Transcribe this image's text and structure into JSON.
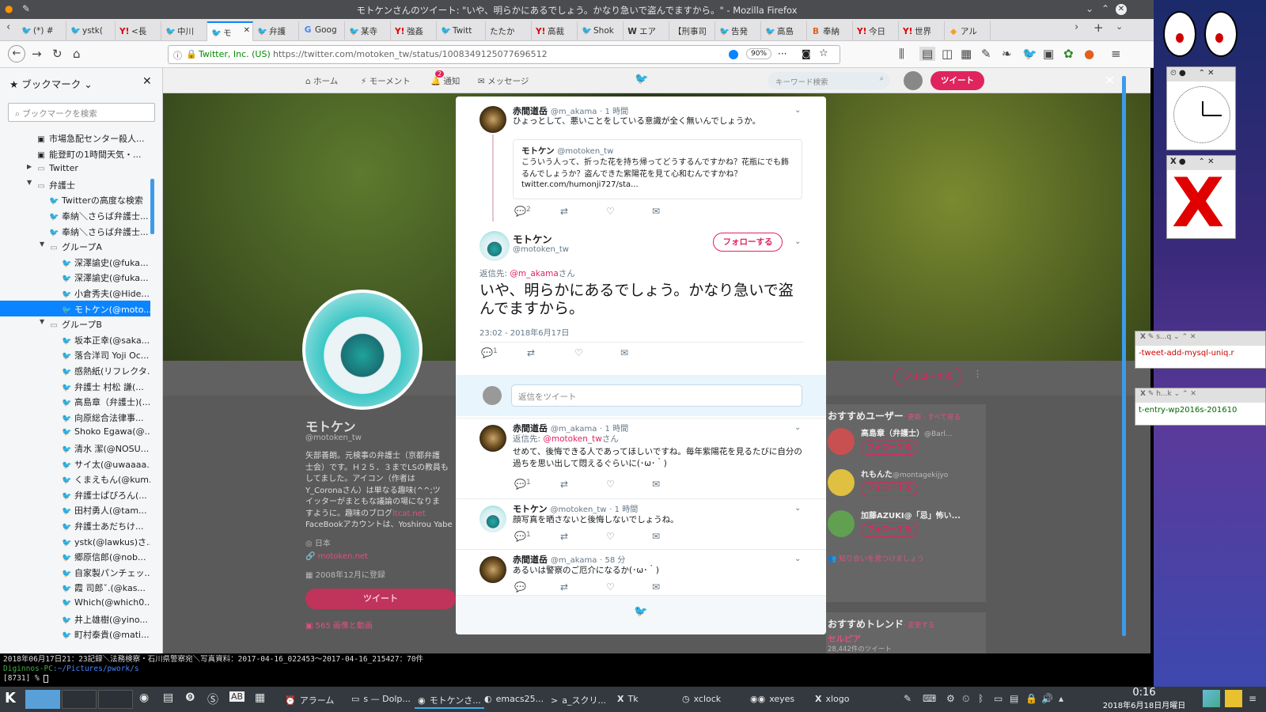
{
  "window": {
    "title": "モトケンさんのツイート: \"いや、明らかにあるでしょう。かなり急いで盗んでますから。\" - Mozilla Firefox"
  },
  "tabs": [
    {
      "label": "(*) #",
      "icon": "t"
    },
    {
      "label": "ystk(",
      "icon": "t"
    },
    {
      "label": "<長",
      "icon": "y"
    },
    {
      "label": "中川",
      "icon": "t"
    },
    {
      "label": "モ",
      "icon": "t",
      "active": true
    },
    {
      "label": "弁護",
      "icon": "t"
    },
    {
      "label": "Goog",
      "icon": "g"
    },
    {
      "label": "某寺",
      "icon": "t"
    },
    {
      "label": "強姦",
      "icon": "y"
    },
    {
      "label": "Twitt",
      "icon": "t"
    },
    {
      "label": "たたか",
      "icon": ""
    },
    {
      "label": "高裁",
      "icon": "y"
    },
    {
      "label": "Shok",
      "icon": "t"
    },
    {
      "label": "エア",
      "icon": "w"
    },
    {
      "label": "【刑事司",
      "icon": ""
    },
    {
      "label": "告発",
      "icon": "t"
    },
    {
      "label": "高島",
      "icon": "t"
    },
    {
      "label": "奉納",
      "icon": "b"
    },
    {
      "label": "今日",
      "icon": "y"
    },
    {
      "label": "世界",
      "icon": "y"
    },
    {
      "label": "アル",
      "icon": "c"
    }
  ],
  "urlbar": {
    "cert": "Twitter, Inc. (US)",
    "url": "https://twitter.com/motoken_tw/status/1008349125077696512",
    "zoom": "90%"
  },
  "sidebar": {
    "title": "ブックマーク",
    "search_placeholder": "ブックマークを検索",
    "items": [
      {
        "label": "市場急配センター殺人...",
        "type": "page",
        "indent": 0
      },
      {
        "label": "能登町の1時間天気・...",
        "type": "page",
        "indent": 0
      },
      {
        "label": "Twitter",
        "type": "folder-closed",
        "indent": 0
      },
      {
        "label": "弁護士",
        "type": "folder-open",
        "indent": 0
      },
      {
        "label": "Twitterの高度な検索",
        "type": "tw",
        "indent": 1
      },
      {
        "label": "奉納＼さらば弁護士...",
        "type": "tw",
        "indent": 1
      },
      {
        "label": "奉納＼さらば弁護士...",
        "type": "tw",
        "indent": 1
      },
      {
        "label": "グループA",
        "type": "folder-open",
        "indent": 1
      },
      {
        "label": "深澤諭史(@fuka...",
        "type": "tw",
        "indent": 2
      },
      {
        "label": "深澤諭史(@fuka...",
        "type": "tw",
        "indent": 2
      },
      {
        "label": "小倉秀夫(@Hide...",
        "type": "tw",
        "indent": 2
      },
      {
        "label": "モトケン(@moto...",
        "type": "tw",
        "indent": 2,
        "selected": true
      },
      {
        "label": "グループB",
        "type": "folder-open",
        "indent": 1
      },
      {
        "label": "坂本正幸(@saka...",
        "type": "tw",
        "indent": 2
      },
      {
        "label": "落合洋司 Yoji Oc...",
        "type": "tw",
        "indent": 2
      },
      {
        "label": "感熱紙(リフレクタ...",
        "type": "tw",
        "indent": 2
      },
      {
        "label": "弁護士 村松 謙(...",
        "type": "tw",
        "indent": 2
      },
      {
        "label": "高島章（弁護士)(...",
        "type": "tw",
        "indent": 2
      },
      {
        "label": "向原総合法律事...",
        "type": "tw",
        "indent": 2
      },
      {
        "label": "Shoko Egawa(@...",
        "type": "tw",
        "indent": 2
      },
      {
        "label": "清水 潔(@NOSU...",
        "type": "tw",
        "indent": 2
      },
      {
        "label": "サイ太(@uwaaaa...",
        "type": "tw",
        "indent": 2
      },
      {
        "label": "くまえもん(@kum...",
        "type": "tw",
        "indent": 2
      },
      {
        "label": "弁護士ぱぴろん(...",
        "type": "tw",
        "indent": 2
      },
      {
        "label": "田村勇人(@tam...",
        "type": "tw",
        "indent": 2
      },
      {
        "label": "弁護士あだちけ...",
        "type": "tw",
        "indent": 2
      },
      {
        "label": "ystk(@lawkus)さ...",
        "type": "tw",
        "indent": 2
      },
      {
        "label": "郷原信郎(@nob...",
        "type": "tw",
        "indent": 2
      },
      {
        "label": "自家製パンチェッ...",
        "type": "tw",
        "indent": 2
      },
      {
        "label": "霞 司郎ˇ.(@kas...",
        "type": "tw",
        "indent": 2
      },
      {
        "label": "Which(@which0...",
        "type": "tw",
        "indent": 2
      },
      {
        "label": "井上雄樹(@yino...",
        "type": "tw",
        "indent": 2
      },
      {
        "label": "町村泰貴(@mati...",
        "type": "tw",
        "indent": 2
      }
    ]
  },
  "twitter_nav": {
    "home": "ホーム",
    "moments": "モーメント",
    "notifications": "通知",
    "notif_badge": "2",
    "messages": "メッセージ",
    "search_placeholder": "キーワード検索",
    "tweet_button": "ツイート"
  },
  "profile": {
    "name": "モトケン",
    "handle": "@motoken_tw",
    "bio_lines": [
      "矢部善朗。元検事の弁護士（京都弁護",
      "士会）です。Ｈ２５．３までLSの教員も",
      "してました。アイコン（作者は",
      "Y_Coronaさん）は単なる趣味(^^;ツ",
      "イッターがまともな議論の場になりま",
      "すように。趣味のブログ",
      "FaceBookアカウントは、Yoshirou Yabe"
    ],
    "blog_link": "ltcat.net",
    "location": "日本",
    "website": "motoken.net",
    "joined": "2008年12月に登録",
    "tweet_button": "ツイート",
    "media": "565 画像と動画",
    "follow_button": "フォローする"
  },
  "recommend": {
    "title": "おすすめユーザー",
    "links": "· 更新 · すべて見る",
    "users": [
      {
        "name": "高島章（弁護士）",
        "handle": "@Barl...",
        "button": "フォローする"
      },
      {
        "name": "れもんた",
        "handle": "@montagekijyo",
        "button": "フォローする"
      },
      {
        "name": "加藤AZUKI@「忌」怖い...",
        "handle": "",
        "button": "フォローする"
      }
    ],
    "find_friends": "知り合いを見つけましょう",
    "trends_title": "おすすめトレンド",
    "trends_change": "· 変更する",
    "trend_name": "セルピア",
    "trend_count": "28,442件のツイート"
  },
  "modal": {
    "parent": {
      "name": "赤間道岳",
      "handle": "@m_akama",
      "time": "· 1 時間",
      "text": "ひょっとして、悪いことをしている意識が全く無いんでしょうか。",
      "quote_name": "モトケン",
      "quote_handle": "@motoken_tw",
      "quote_text": "こういう人って、折った花を持ち帰ってどうするんですかね？花瓶にでも飾るんでしょうか？盗んできた紫陽花を見て心和むんですかね？",
      "quote_link": "twitter.com/humonji727/sta...",
      "replies": "2"
    },
    "main": {
      "name": "モトケン",
      "handle": "@motoken_tw",
      "follow": "フォローする",
      "reply_prefix": "返信先: ",
      "reply_user": "@m_akama",
      "reply_suffix": "さん",
      "text": "いや、明らかにあるでしょう。かなり急いで盗んでますから。",
      "timestamp": "23:02 - 2018年6月17日",
      "replies": "1"
    },
    "reply_placeholder": "返信をツイート",
    "replies": [
      {
        "name": "赤間道岳",
        "handle": "@m_akama",
        "time": "· 1 時間",
        "reply_user": "@motoken_tw",
        "text": "せめて、後悔できる人であってほしいですね。毎年紫陽花を見るたびに自分の過ちを思い出して悶えるぐらいに(･ω･｀)",
        "count": "1",
        "avatar": "kin"
      },
      {
        "name": "モトケン",
        "handle": "@motoken_tw",
        "time": "· 1 時間",
        "reply_user": "",
        "text": "顔写真を晒さないと後悔しないでしょうね。",
        "count": "1",
        "avatar": "mk"
      },
      {
        "name": "赤間道岳",
        "handle": "@m_akama",
        "time": "· 58 分",
        "reply_user": "",
        "text": "あるいは警察のご厄介になるか(･ω･｀)",
        "count": "",
        "avatar": "kin"
      }
    ]
  },
  "right_windows": [
    {
      "text": "-tweet-add-mysql-uniq.r",
      "title": "s...q"
    },
    {
      "text": "t-entry-wp2016s-201610",
      "title": "h...k"
    }
  ],
  "terminal": {
    "line1": "2018年06月17日21：23記録＼法務検察・石川県警察宛＼写真資料：2017-04-16_022453〜2017-04-16_215427：70件",
    "prompt_host": "Diginnos-PC",
    "prompt_path": ":~/Pictures/pwork/s",
    "line3": "[8731]  % "
  },
  "taskbar": {
    "items": [
      "アラーム",
      "s — Dolp...",
      "モトケンさ...",
      "emacs25...",
      "a_スクリ...",
      "Tk",
      "xclock",
      "xeyes",
      "xlogo"
    ],
    "clock_time": "0:16",
    "clock_date": "2018年6月18日月曜日"
  },
  "colors": {
    "twitter_blue": "#1da1f2",
    "accent_red": "#e0245e",
    "firefox_blue": "#0a84ff"
  }
}
